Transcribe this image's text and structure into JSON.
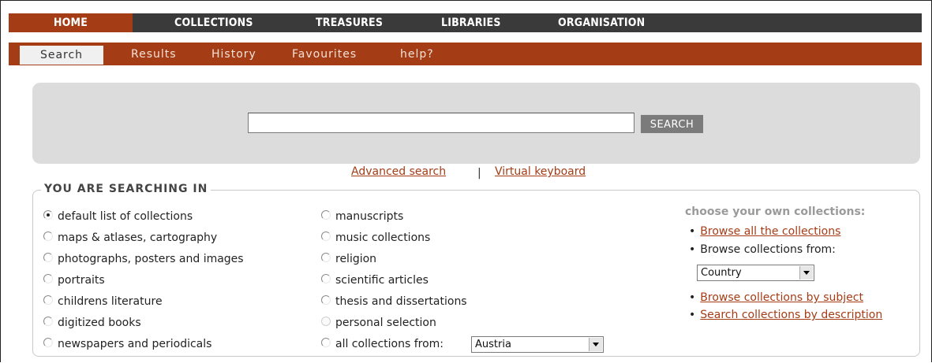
{
  "topnav": {
    "tabs": [
      {
        "label": "HOME",
        "active": true
      },
      {
        "label": "COLLECTIONS",
        "active": false
      },
      {
        "label": "TREASURES",
        "active": false
      },
      {
        "label": "LIBRARIES",
        "active": false
      },
      {
        "label": "ORGANISATION",
        "active": false
      }
    ]
  },
  "subnav": {
    "items": [
      {
        "label": "Search",
        "active": true
      },
      {
        "label": "Results",
        "active": false
      },
      {
        "label": "History",
        "active": false
      },
      {
        "label": "Favourites",
        "active": false
      },
      {
        "label": "help?",
        "active": false
      }
    ]
  },
  "search": {
    "input_value": "",
    "button_label": "SEARCH"
  },
  "links": {
    "advanced": "Advanced search",
    "separator": "|",
    "keyboard": "Virtual keyboard"
  },
  "searching_in": {
    "legend": "YOU ARE SEARCHING IN",
    "left_options": [
      {
        "label": "default list of collections",
        "checked": true
      },
      {
        "label": "maps & atlases, cartography",
        "checked": false
      },
      {
        "label": "photographs, posters and images",
        "checked": false
      },
      {
        "label": "portraits",
        "checked": false
      },
      {
        "label": "childrens literature",
        "checked": false
      },
      {
        "label": "digitized books",
        "checked": false
      },
      {
        "label": "newspapers and periodicals",
        "checked": false
      }
    ],
    "middle_options": [
      {
        "label": "manuscripts",
        "checked": false
      },
      {
        "label": "music collections",
        "checked": false
      },
      {
        "label": "religion",
        "checked": false
      },
      {
        "label": "scientific articles",
        "checked": false
      },
      {
        "label": "thesis and dissertations",
        "checked": false
      },
      {
        "label": "personal selection",
        "checked": false,
        "disabled": true
      },
      {
        "label": "all collections from:",
        "checked": false
      }
    ],
    "country_select_value": "Austria"
  },
  "own_collections": {
    "title": "choose your own collections:",
    "browse_all": "Browse all the collections",
    "browse_from": "Browse collections from:",
    "from_select_value": "Country",
    "by_subject": "Browse collections by subject",
    "by_description": "Search collections by description"
  },
  "colors": {
    "accent": "#a43c16",
    "nav_dark": "#3a3a3a",
    "panel_grey": "#dcdcdc"
  }
}
